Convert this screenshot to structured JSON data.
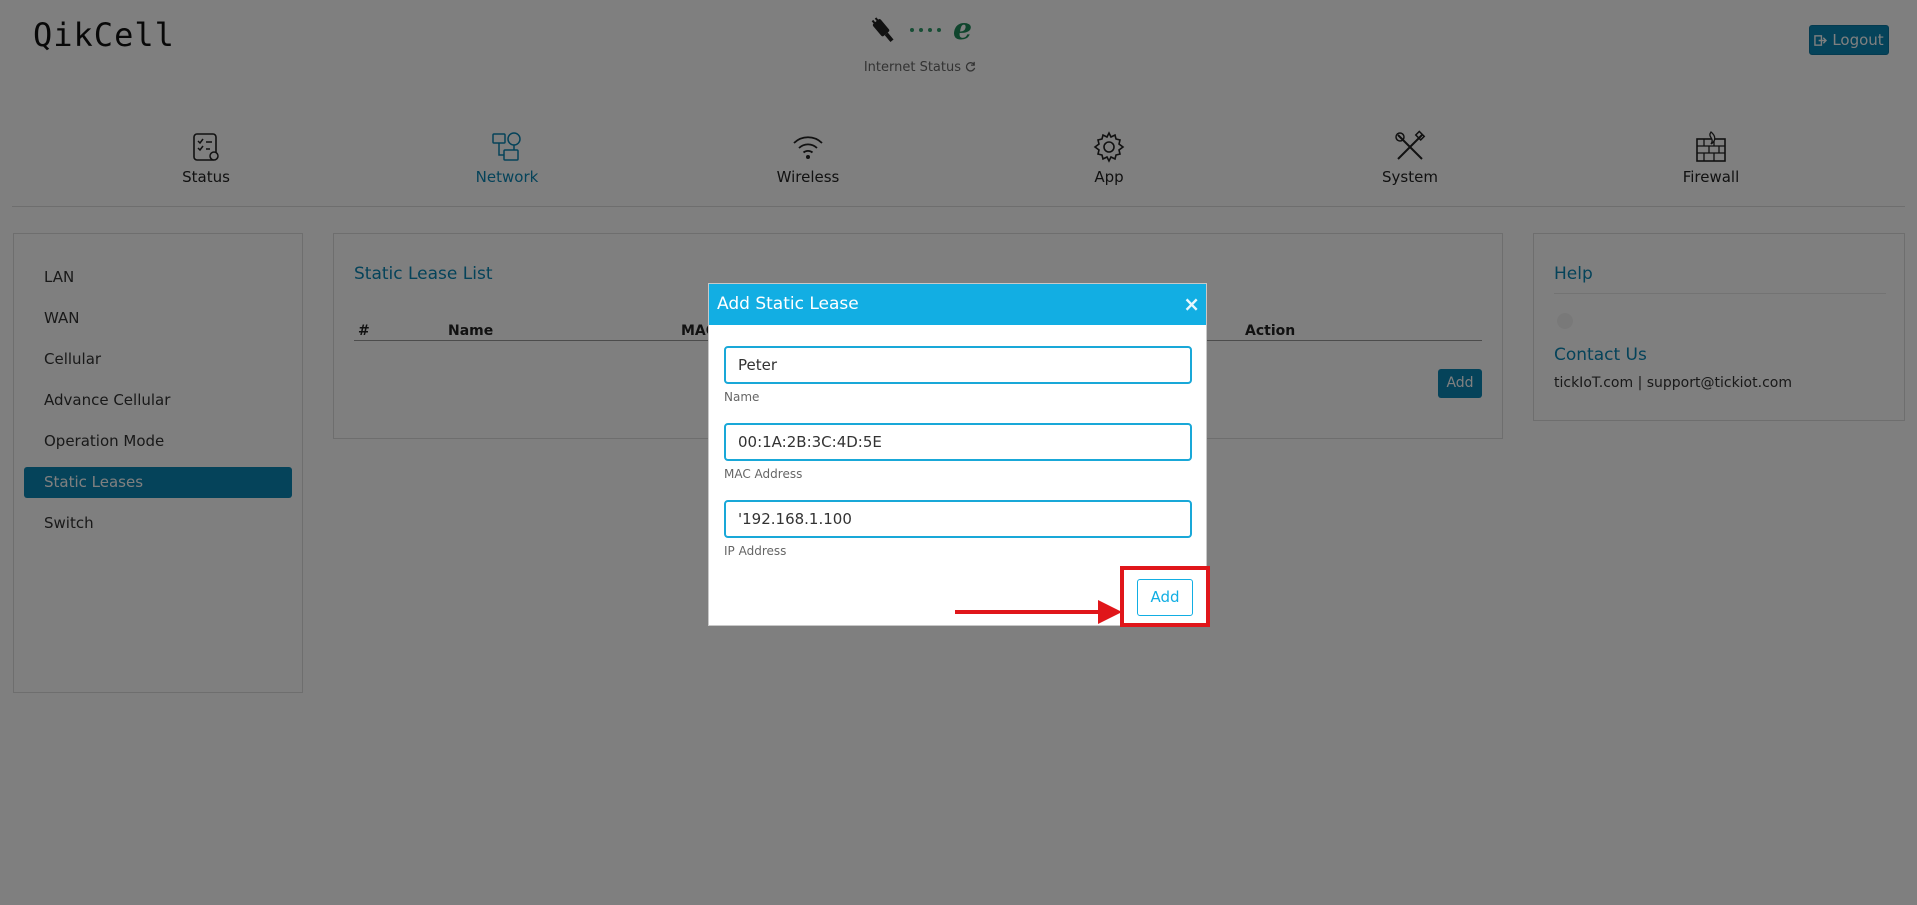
{
  "header": {
    "logo": "QikCell",
    "internet_status_label": "Internet Status",
    "logout_label": "Logout"
  },
  "nav": {
    "items": [
      {
        "label": "Status",
        "icon": "status-checklist-icon"
      },
      {
        "label": "Network",
        "icon": "network-icon",
        "active": true
      },
      {
        "label": "Wireless",
        "icon": "wifi-icon"
      },
      {
        "label": "App",
        "icon": "gear-icon"
      },
      {
        "label": "System",
        "icon": "tools-icon"
      },
      {
        "label": "Firewall",
        "icon": "firewall-icon"
      }
    ]
  },
  "sidebar": {
    "items": [
      {
        "label": "LAN"
      },
      {
        "label": "WAN"
      },
      {
        "label": "Cellular"
      },
      {
        "label": "Advance Cellular"
      },
      {
        "label": "Operation Mode"
      },
      {
        "label": "Static Leases",
        "active": true
      },
      {
        "label": "Switch"
      }
    ]
  },
  "main": {
    "title": "Static Lease List",
    "columns": [
      "#",
      "Name",
      "MAC",
      "Action"
    ],
    "add_label": "Add"
  },
  "help": {
    "title": "Help",
    "contact_title": "Contact Us",
    "contact_text": "tickIoT.com | support@tickiot.com"
  },
  "modal": {
    "title": "Add Static Lease",
    "close": "×",
    "fields": [
      {
        "value": "Peter",
        "label": "Name"
      },
      {
        "value": "00:1A:2B:3C:4D:5E",
        "label": "MAC Address"
      },
      {
        "value": "'192.168.1.100",
        "label": "IP Address"
      }
    ],
    "add_label": "Add"
  },
  "colors": {
    "accent": "#0b86b4",
    "modal_header": "#12aee3",
    "annotation": "#e0161a"
  }
}
